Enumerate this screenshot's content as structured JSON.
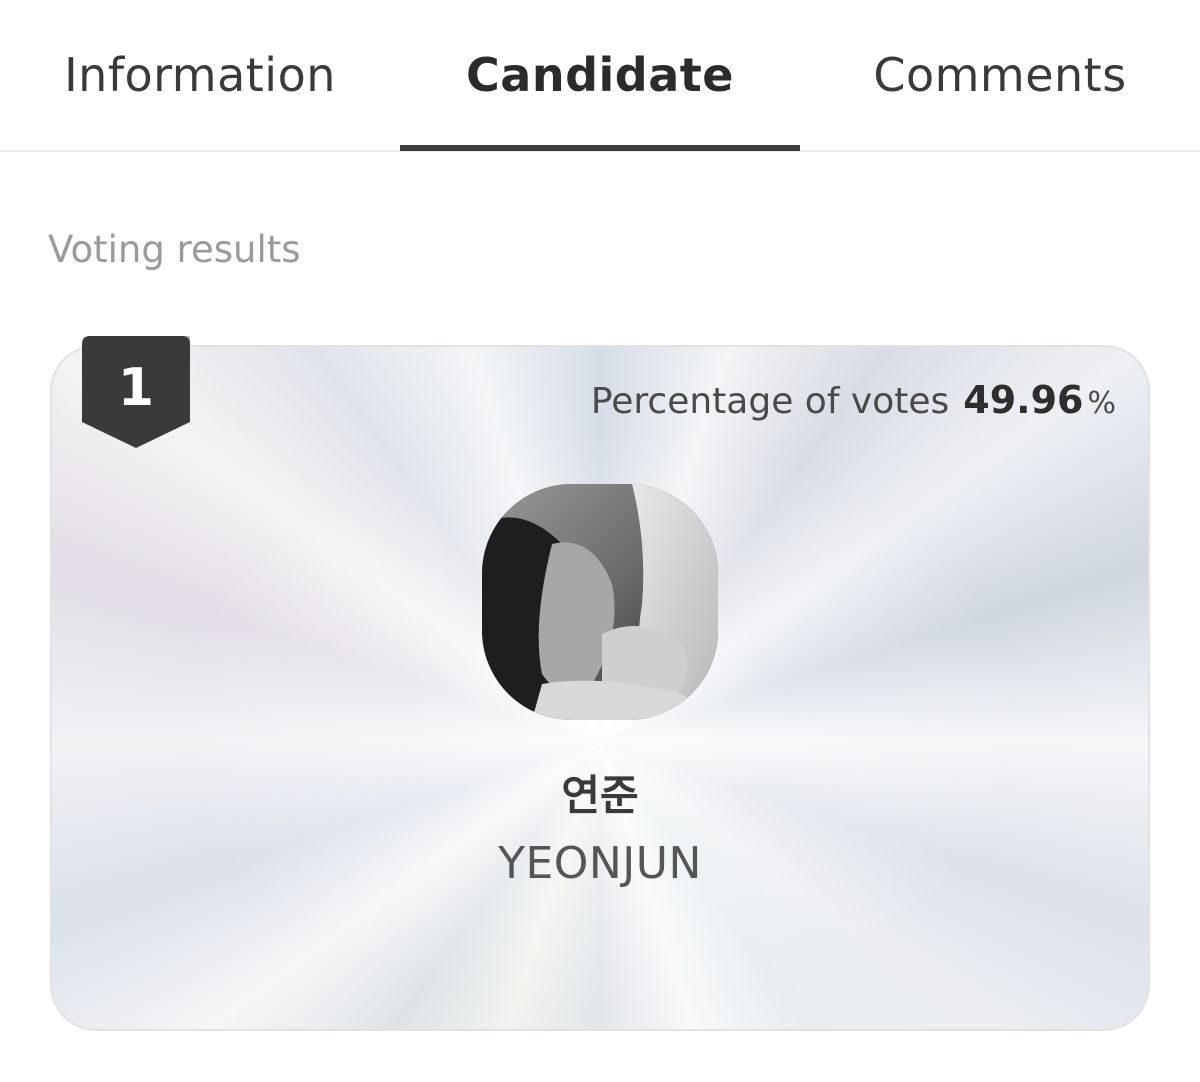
{
  "tabs": [
    {
      "label": "Information",
      "active": false
    },
    {
      "label": "Candidate",
      "active": true
    },
    {
      "label": "Comments",
      "active": false
    }
  ],
  "section": {
    "title": "Voting results"
  },
  "candidate": {
    "rank": "1",
    "percentage_label": "Percentage of votes",
    "percentage_value": "49.96",
    "percentage_unit": "%",
    "name_korean": "연준",
    "name_english": "YEONJUN",
    "avatar_icon": "candidate-photo"
  },
  "colors": {
    "badge": "#3a3a3a",
    "tab_underline": "#3c3c3c",
    "section_title": "#9a9a9a"
  }
}
